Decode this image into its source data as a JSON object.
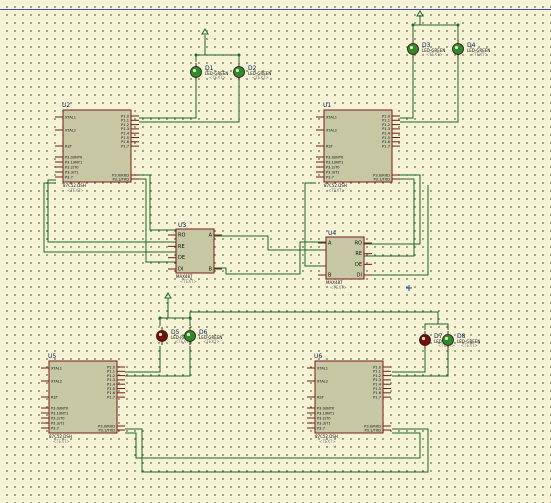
{
  "schematic": {
    "mcus": [
      {
        "ref": "U2",
        "part": "87C52.DSH",
        "text": "<TEXT>",
        "pins_left": [
          "XTAL1",
          "XTAL2",
          "RST",
          "P3.0/INT0",
          "P3.1/INT1",
          "P3.2/T0",
          "P3.3/T1",
          "P3.7"
        ],
        "pins_right": [
          "P1.0",
          "P1.1",
          "P1.2",
          "P1.3",
          "P1.4",
          "P1.5",
          "P1.6",
          "P1.7",
          "P3.0/RXD",
          "P3.1/TXD"
        ]
      },
      {
        "ref": "U1",
        "part": "87C52.DSH",
        "text": "<TEXT>",
        "pins_left": [
          "XTAL1",
          "XTAL2",
          "RST",
          "P3.0/INT0",
          "P3.1/INT1",
          "P3.2/T0",
          "P3.3/T1",
          "P3.7"
        ],
        "pins_right": [
          "P1.0",
          "P1.1",
          "P1.2",
          "P1.3",
          "P1.4",
          "P1.5",
          "P1.6",
          "P1.7",
          "P3.0/RXD",
          "P3.1/TXD"
        ]
      },
      {
        "ref": "U5",
        "part": "87C52.DSH",
        "text": "<TEXT>",
        "pins_left": [
          "XTAL1",
          "XTAL2",
          "RST",
          "P3.0/INT0",
          "P3.1/INT1",
          "P3.2/T0",
          "P3.3/T1",
          "P3.7"
        ],
        "pins_right": [
          "P1.0",
          "P1.1",
          "P1.2",
          "P1.3",
          "P1.4",
          "P1.5",
          "P1.6",
          "P1.7",
          "P3.0/RXD",
          "P3.1/TXD"
        ]
      },
      {
        "ref": "U6",
        "part": "87C52.DSH",
        "text": "<TEXT>",
        "pins_left": [
          "XTAL1",
          "XTAL2",
          "RST",
          "P3.0/INT0",
          "P3.1/INT1",
          "P3.2/T0",
          "P3.3/T1",
          "P3.7"
        ],
        "pins_right": [
          "P1.0",
          "P1.1",
          "P1.2",
          "P1.3",
          "P1.4",
          "P1.5",
          "P1.6",
          "P1.7",
          "P3.0/RXD",
          "P3.1/TXD"
        ]
      }
    ],
    "transceivers": [
      {
        "ref": "U3",
        "part": "MAX487",
        "text": "<TEXT>",
        "pins": [
          "RO",
          "RE",
          "DE",
          "DI",
          "A",
          "B"
        ]
      },
      {
        "ref": "U4",
        "part": "MAX487",
        "text": "<TEXT>",
        "pins": [
          "A",
          "B",
          "RO",
          "RE",
          "DE",
          "DI"
        ]
      }
    ],
    "leds": [
      {
        "ref": "D1",
        "part": "LED-GREEN",
        "text": "<TEXT>",
        "color": "#2f8a2a"
      },
      {
        "ref": "D2",
        "part": "LED-GREEN",
        "text": "<TEXT>",
        "color": "#2f8a2a"
      },
      {
        "ref": "D3",
        "part": "LED-GREEN",
        "text": "<TEXT>",
        "color": "#2f8a2a"
      },
      {
        "ref": "D4",
        "part": "LED-GREEN",
        "text": "<TEXT>",
        "color": "#2f8a2a"
      },
      {
        "ref": "D5",
        "part": "LED-RED",
        "text": "<TEXT>",
        "color": "#7a0c0c"
      },
      {
        "ref": "D6",
        "part": "LED-GREEN",
        "text": "<TEXT>",
        "color": "#2f8a2a"
      },
      {
        "ref": "D7",
        "part": "LED-RED",
        "text": "<TEXT>",
        "color": "#7a0c0c"
      },
      {
        "ref": "D8",
        "part": "LED-GREEN",
        "text": "<TEXT>",
        "color": "#2f8a2a"
      }
    ],
    "colors": {
      "wire": "#1a6a2a",
      "chip_fill": "#c6c8a4",
      "chip_border": "#7a1a1a",
      "label": "#102060",
      "background": "#f5f2d6"
    }
  }
}
